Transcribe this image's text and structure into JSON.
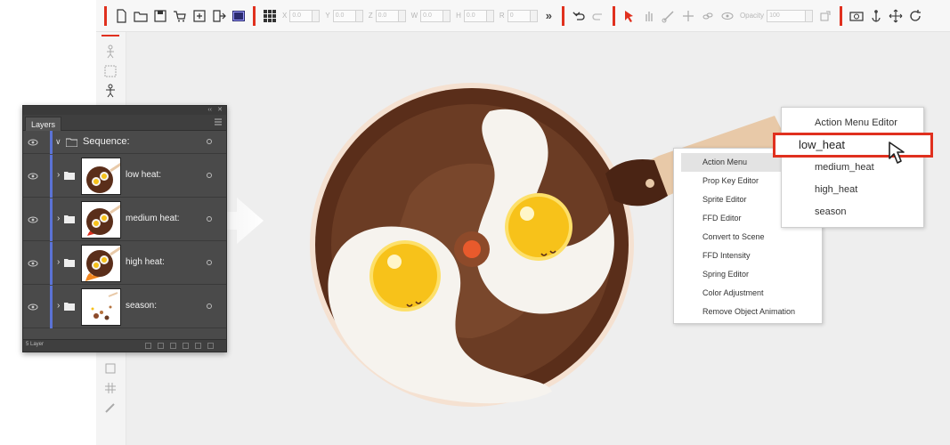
{
  "toolbar": {
    "fields": [
      {
        "label": "X",
        "value": "0.0"
      },
      {
        "label": "Y",
        "value": "0.0"
      },
      {
        "label": "Z",
        "value": "0.0"
      },
      {
        "label": "W",
        "value": "0.0"
      },
      {
        "label": "H",
        "value": "0.0"
      },
      {
        "label": "R",
        "value": "0"
      }
    ],
    "more_glyph": "»",
    "opacity_label": "Opacity",
    "opacity_value": "100"
  },
  "layers_panel": {
    "tab_label": "Layers",
    "sequence": {
      "label": "Sequence:"
    },
    "items": [
      {
        "label": "low heat:",
        "icon": "folder-icon"
      },
      {
        "label": "medium heat:",
        "icon": "folder-icon"
      },
      {
        "label": "high heat:",
        "icon": "folder-icon"
      },
      {
        "label": "season:",
        "icon": "folder-icon"
      }
    ],
    "footer_count": "5 Layer"
  },
  "context_menu": {
    "items": [
      "Action Menu",
      "Prop Key Editor",
      "Sprite Editor",
      "FFD Editor",
      "Convert to Scene",
      "FFD Intensity",
      "Spring Editor",
      "Color Adjustment",
      "Remove Object Animation"
    ]
  },
  "submenu": {
    "items": [
      "Action Menu Editor",
      "low_heat",
      "medium_heat",
      "high_heat",
      "season"
    ],
    "highlighted_index": 1
  },
  "colors": {
    "accent_red": "#e0301e",
    "pan_brown": "#5a2e1a",
    "pan_inner": "#6b3c24",
    "egg_yolk": "#f7c21a",
    "panel_bg": "#4a4a4a",
    "layer_bar": "#5b73d6"
  }
}
